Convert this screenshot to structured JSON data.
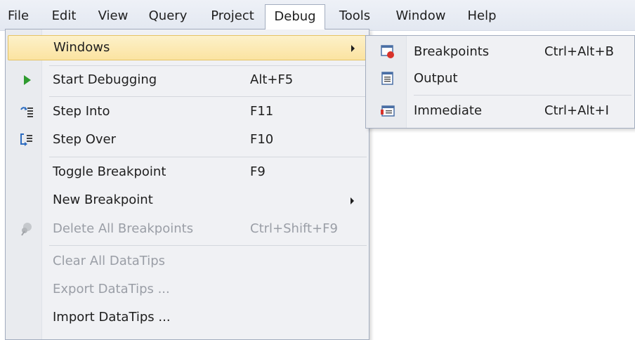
{
  "menubar": {
    "items": [
      {
        "label": "File"
      },
      {
        "label": "Edit"
      },
      {
        "label": "View"
      },
      {
        "label": "Query"
      },
      {
        "label": "Project"
      },
      {
        "label": "Debug"
      },
      {
        "label": "Tools"
      },
      {
        "label": "Window"
      },
      {
        "label": "Help"
      }
    ],
    "active": "Debug"
  },
  "debug_menu": {
    "windows": {
      "label": "Windows",
      "icon": "none",
      "has_submenu": true
    },
    "start_debugging": {
      "label": "Start Debugging",
      "shortcut": "Alt+F5",
      "icon": "play-icon"
    },
    "step_into": {
      "label": "Step Into",
      "shortcut": "F11",
      "icon": "step-into-icon"
    },
    "step_over": {
      "label": "Step Over",
      "shortcut": "F10",
      "icon": "step-over-icon"
    },
    "toggle_breakpoint": {
      "label": "Toggle Breakpoint",
      "shortcut": "F9"
    },
    "new_breakpoint": {
      "label": "New Breakpoint",
      "has_submenu": true
    },
    "delete_all_breakpoints": {
      "label": "Delete All Breakpoints",
      "shortcut": "Ctrl+Shift+F9",
      "disabled": true,
      "icon": "delete-breakpoints-icon"
    },
    "clear_all_datatips": {
      "label": "Clear All DataTips",
      "disabled": true
    },
    "export_datatips": {
      "label": "Export DataTips ...",
      "disabled": true
    },
    "import_datatips": {
      "label": "Import DataTips ..."
    }
  },
  "windows_submenu": {
    "breakpoints": {
      "label": "Breakpoints",
      "shortcut": "Ctrl+Alt+B",
      "icon": "breakpoints-window-icon"
    },
    "output": {
      "label": "Output",
      "icon": "output-window-icon"
    },
    "immediate": {
      "label": "Immediate",
      "shortcut": "Ctrl+Alt+I",
      "icon": "immediate-window-icon"
    }
  },
  "colors": {
    "highlight": "#fbe3a1",
    "menu_background": "#f0f1f4",
    "disabled_text": "#9a9ea6"
  }
}
